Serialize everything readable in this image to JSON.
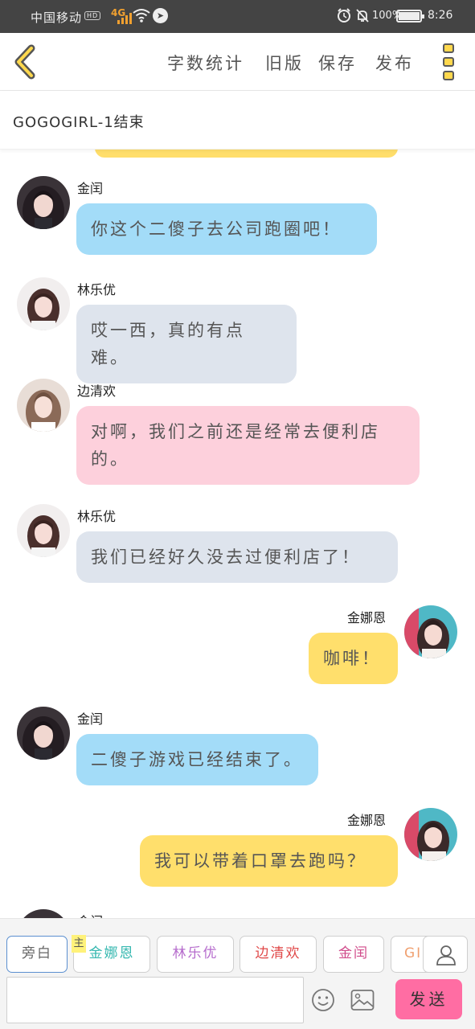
{
  "status_bar": {
    "carrier": "中国移动",
    "hd": "HD",
    "network": "4G",
    "battery": "100%",
    "time": "8:26"
  },
  "toolbar": {
    "word_count": "字数统计",
    "old_version": "旧版",
    "save": "保存",
    "publish": "发布"
  },
  "story": {
    "title": "GOGOGIRL-1结束"
  },
  "messages": [
    {
      "sender": "金闰",
      "text": "你这个二傻子去公司跑圈吧！",
      "side": "left",
      "color": "#a3dcf8"
    },
    {
      "sender": "林乐优",
      "text": "哎一西，真的有点难。",
      "side": "left",
      "color": "#dee4ed"
    },
    {
      "sender": "边清欢",
      "text": "对啊，我们之前还是经常去便利店的。",
      "side": "left",
      "color": "#fdd0dc"
    },
    {
      "sender": "林乐优",
      "text": "我们已经好久没去过便利店了！",
      "side": "left",
      "color": "#dee4ed"
    },
    {
      "sender": "金娜恩",
      "text": "咖啡！",
      "side": "right",
      "color": "#ffdf6c"
    },
    {
      "sender": "金闰",
      "text": "二傻子游戏已经结束了。",
      "side": "left",
      "color": "#a3dcf8"
    },
    {
      "sender": "金娜恩",
      "text": "我可以带着口罩去跑吗？",
      "side": "right",
      "color": "#ffdf6c"
    },
    {
      "sender": "金闰",
      "text": "",
      "side": "left",
      "color": "#a3dcf8"
    }
  ],
  "role_bar": {
    "narration": "旁白",
    "main_badge": "主",
    "roles": [
      "金娜恩",
      "林乐优",
      "边清欢",
      "金闰",
      "GIF"
    ]
  },
  "composer": {
    "input_value": "",
    "input_placeholder": "",
    "send": "发送"
  },
  "icons": {
    "back": "chevron-left-icon",
    "more": "more-icon",
    "user": "user-icon",
    "emoji": "emoji-icon",
    "image": "image-icon"
  },
  "colors": {
    "accent_yellow": "#ffd84d",
    "send_button": "#ff6da3",
    "bubble_blue": "#a3dcf8",
    "bubble_grey": "#dee4ed",
    "bubble_pink": "#fdd0dc",
    "bubble_yellow": "#ffdf6c"
  }
}
